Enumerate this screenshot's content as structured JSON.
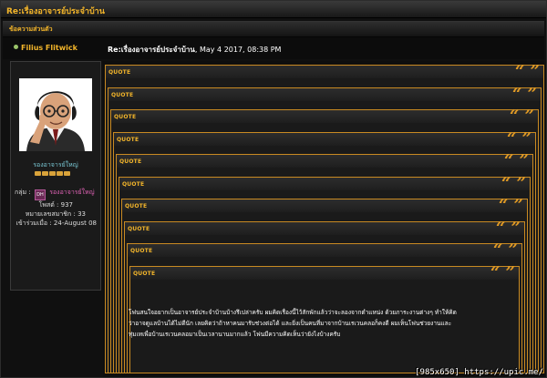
{
  "topic_title": "Re:เรื่องอาจารย์ประจำบ้าน",
  "section_label": "ข้อความส่วนตัว",
  "author": {
    "name": "Filius Flitwick",
    "rank_title": "รองอาจารย์ใหญ่",
    "stars": 5,
    "group_label": "กลุ่ม :",
    "group_badge": "DH",
    "group_name": "รองอาจารย์ใหญ่",
    "posts": "โพสต์ : 937",
    "member_number": "หมายเลขสมาชิก : 33",
    "joined": "เข้าร่วมเมื่อ : 24-August 08"
  },
  "post": {
    "subject": "Re:เรื่องอาจารย์ประจำบ้าน",
    "date": ", May 4 2017, 08:38 PM"
  },
  "quotes": {
    "label": "QUOTE",
    "marks": "“ ”",
    "depth": 10
  },
  "message": "โฟนสนใจอยากเป็นอาจารย์ประจำบ้านบ้างรึเปล่าครับ ผมคิดเรื่องนี้ไว้สักพักแล้วว่าจะลองจากตำแหน่ง ด้วยภาระงานต่างๆ ทำให้คิดว่าอาจดูแลบ้านได้ไม่ดีนัก เลยคิดว่าถ้าหาคนมารับช่วงต่อได้ และยิ่งเป็นคนที่มาจากบ้านเรเวนคลอก็คงดี ผมเห็นโฟนช่วยงานและ ทุ่มเทเพื่อบ้านเรเวนคลอมาเป็นเวลานานมากแล้ว โฟนมีความคิดเห็นว่ายังไงบ้างครับ",
  "watermark": "[985x650] https://upic.me/"
}
